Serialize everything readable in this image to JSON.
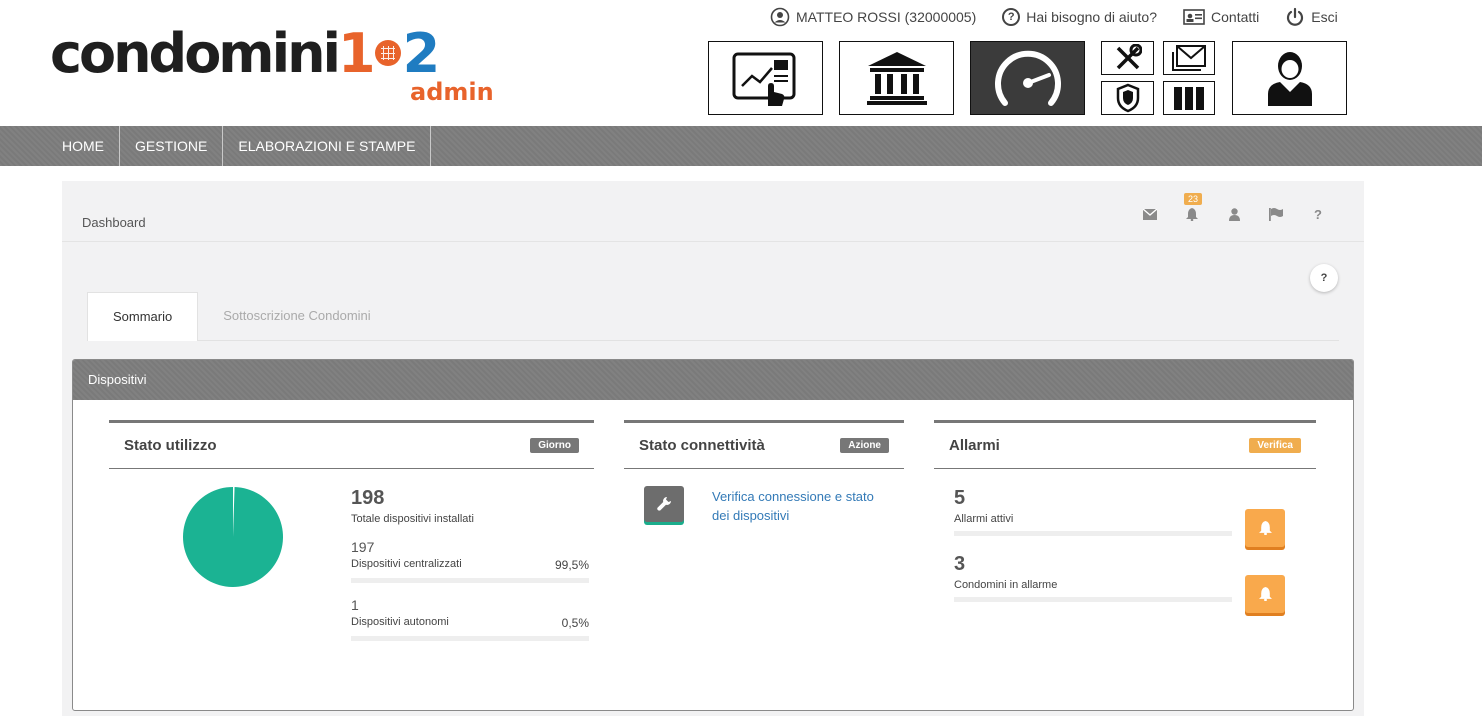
{
  "brand": {
    "logo_text": "condomini",
    "logo_one": "1",
    "logo_two": "2",
    "logo_sub": "admin",
    "orange": "#e8632b",
    "blue": "#1f7cc1"
  },
  "topbar": {
    "user": "MATTEO ROSSI (32000005)",
    "help": "Hai bisogno di aiuto?",
    "contacts": "Contatti",
    "logout": "Esci"
  },
  "app_icons": [
    "dashboard-touch-icon",
    "bank-icon",
    "speedometer-icon",
    "tools-icon",
    "mail-icon",
    "shield-icon",
    "binders-icon",
    "user-icon"
  ],
  "nav": {
    "items": [
      "HOME",
      "GESTIONE",
      "ELABORAZIONI E STAMPE"
    ]
  },
  "breadcrumb": "Dashboard",
  "header_icons": {
    "notifications_badge": "23",
    "help": "?"
  },
  "help_button": "?",
  "tabs": [
    {
      "label": "Sommario",
      "active": true
    },
    {
      "label": "Sottoscrizione Condomini",
      "active": false
    }
  ],
  "panel": {
    "title": "Dispositivi",
    "usage": {
      "title": "Stato utilizzo",
      "label": "Giorno",
      "total": "198",
      "total_label": "Totale dispositivi installati",
      "centralized": "197",
      "centralized_label": "Dispositivi centralizzati",
      "centralized_pct": "99,5%",
      "autonomous": "1",
      "autonomous_label": "Dispositivi autonomi",
      "autonomous_pct": "0,5%",
      "pie_color": "#1bb393",
      "centralized_fraction": 0.995
    },
    "connectivity": {
      "title": "Stato connettività",
      "label": "Azione",
      "link": "Verifica connessione e stato dei dispositivi"
    },
    "alarms": {
      "title": "Allarmi",
      "label": "Verifica",
      "active": "5",
      "active_label": "Allarmi attivi",
      "condos": "3",
      "condos_label": "Condomini in allarme"
    }
  }
}
